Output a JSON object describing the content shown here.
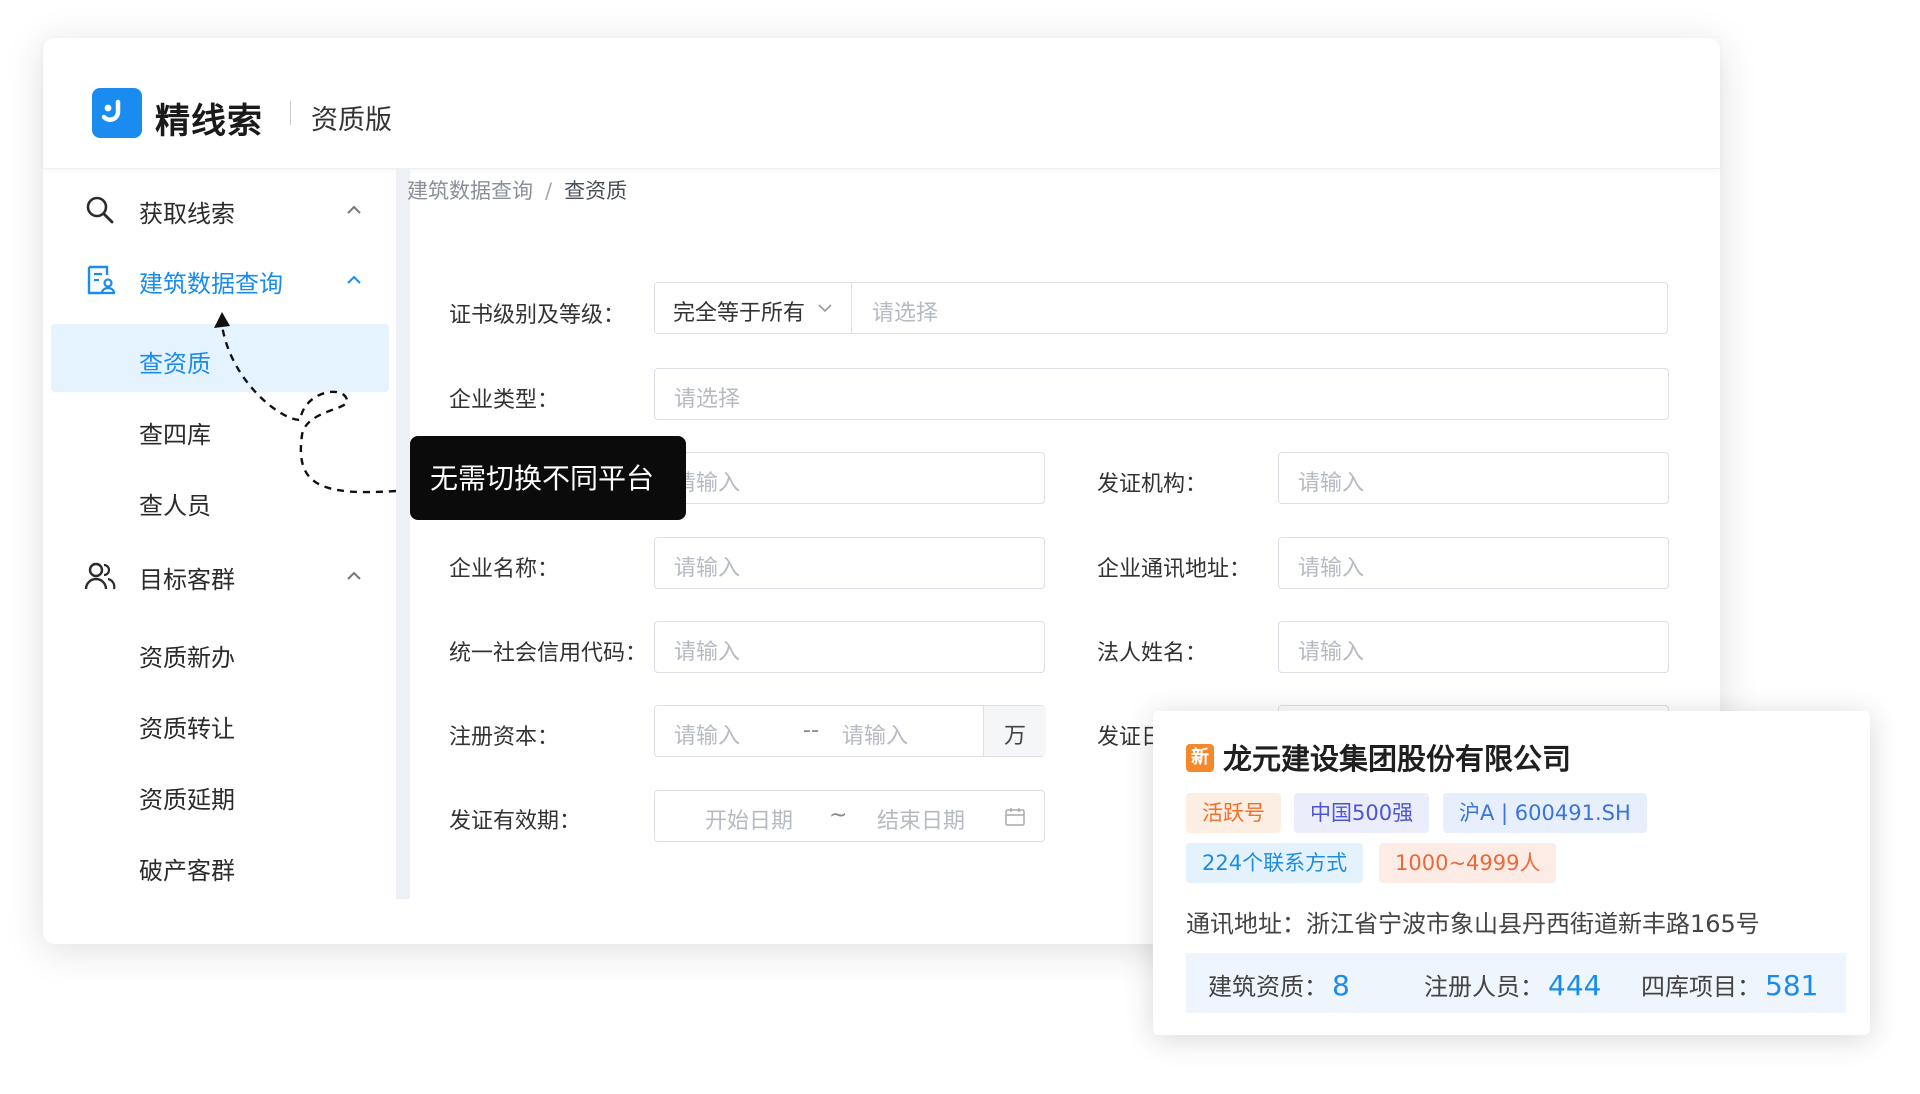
{
  "header": {
    "brand": "精线索",
    "edition": "资质版",
    "brand_color": "#1a8cf0"
  },
  "sidebar": {
    "groups": [
      {
        "label": "获取线索",
        "icon": "search-icon",
        "active": false
      },
      {
        "label": "建筑数据查询",
        "icon": "document-user-icon",
        "active": true
      },
      {
        "label": "目标客群",
        "icon": "users-icon",
        "active": false
      }
    ],
    "sub_items_query": [
      "查资质",
      "查四库",
      "查人员"
    ],
    "sub_items_target": [
      "资质新办",
      "资质转让",
      "资质延期",
      "破产客群"
    ],
    "selected": "查资质"
  },
  "breadcrumb": {
    "parent": "建筑数据查询",
    "separator": "/",
    "current": "查资质"
  },
  "form": {
    "cert_level_label": "证书级别及等级：",
    "match_mode_value": "完全等于所有",
    "cert_level_placeholder": "请选择",
    "company_type_label": "企业类型：",
    "company_type_placeholder": "请选择",
    "cert_number_placeholder": "请输入",
    "issuing_authority_label": "发证机构：",
    "issuing_authority_placeholder": "请输入",
    "company_name_label": "企业名称：",
    "company_name_placeholder": "请输入",
    "company_address_label": "企业通讯地址：",
    "company_address_placeholder": "请输入",
    "credit_code_label": "统一社会信用代码：",
    "credit_code_placeholder": "请输入",
    "legal_person_label": "法人姓名：",
    "legal_person_placeholder": "请输入",
    "capital_label": "注册资本：",
    "capital_min_placeholder": "请输入",
    "capital_dash": "--",
    "capital_max_placeholder": "请输入",
    "capital_unit": "万",
    "issue_date_label_partial": "发证日",
    "validity_label": "发证有效期：",
    "start_date_placeholder": "开始日期",
    "date_sep": "~",
    "end_date_placeholder": "结束日期"
  },
  "tooltip": {
    "text": "无需切换不同平台"
  },
  "company_card": {
    "new_badge": "新",
    "name": "龙元建设集团股份有限公司",
    "tags": [
      {
        "text": "活跃号",
        "color": "#f2702a",
        "bg": "#fdeee4"
      },
      {
        "text": "中国500强",
        "color": "#4d55d6",
        "bg": "#ebedfb"
      },
      {
        "text": "沪A | 600491.SH",
        "color": "#3a74d8",
        "bg": "#e6effb"
      },
      {
        "text": "224个联系方式",
        "color": "#1e8ce0",
        "bg": "#e3f2fd"
      },
      {
        "text": "1000~4999人",
        "color": "#e86a3a",
        "bg": "#fdece5"
      }
    ],
    "address_label": "通讯地址：",
    "address": "浙江省宁波市象山县丹西街道新丰路165号",
    "stats": [
      {
        "label": "建筑资质：",
        "value": "8"
      },
      {
        "label": "注册人员：",
        "value": "444"
      },
      {
        "label": "四库项目：",
        "value": "581"
      }
    ]
  }
}
